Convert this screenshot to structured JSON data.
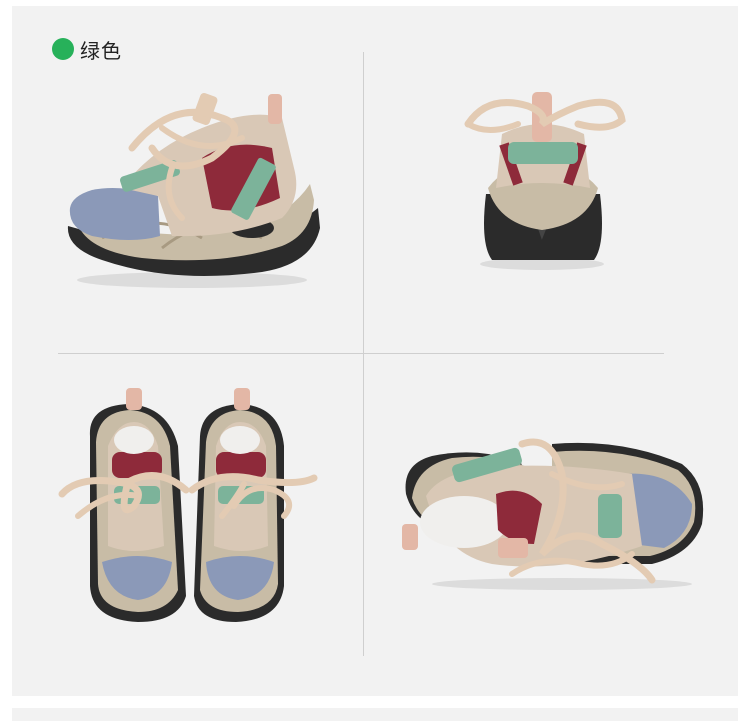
{
  "variant": {
    "label": "绿色",
    "dot_color": "#27b15a"
  },
  "images": [
    {
      "name": "shoe-side-view-icon"
    },
    {
      "name": "shoe-back-view-icon"
    },
    {
      "name": "shoe-top-pair-view-icon"
    },
    {
      "name": "shoe-inner-side-view-icon"
    }
  ],
  "colors": {
    "background": "#f2f2f2",
    "lace": "#e3cbb3",
    "suede_blue": "#8a98b8",
    "burgundy": "#8e2a3a",
    "sage_green": "#7cb39a",
    "sole_metallic": "#c9bda6",
    "outsole_black": "#2a2a2a"
  }
}
